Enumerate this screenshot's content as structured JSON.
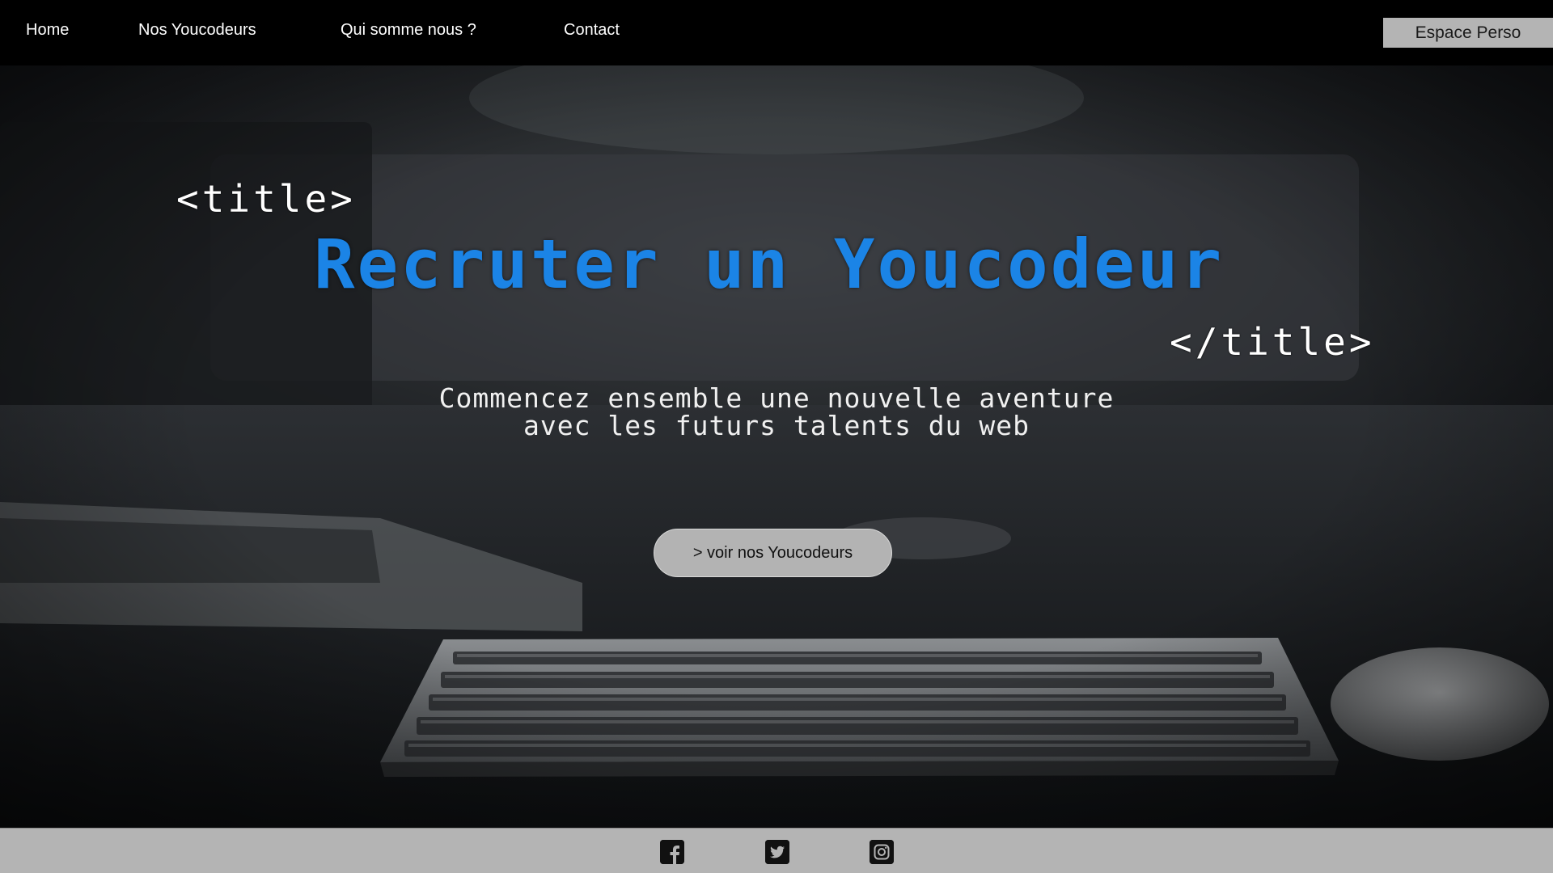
{
  "nav": {
    "home": "Home",
    "youcodeurs": "Nos Youcodeurs",
    "about": "Qui somme nous ?",
    "contact": "Contact",
    "espace_perso": "Espace Perso"
  },
  "hero": {
    "tag_open": "<title>",
    "title": "Recruter un Youcodeur",
    "tag_close": "</title>",
    "subtitle_line1": "Commencez ensemble une nouvelle aventure",
    "subtitle_line2": "avec les futurs talents du web",
    "cta_label": "> voir nos Youcodeurs"
  },
  "footer": {
    "icons": [
      "facebook-icon",
      "twitter-icon",
      "instagram-icon"
    ]
  },
  "colors": {
    "nav_bg": "#000000",
    "accent_blue": "#1b84e6",
    "button_gray": "#b3b3b3",
    "footer_gray": "#b4b4b4"
  }
}
